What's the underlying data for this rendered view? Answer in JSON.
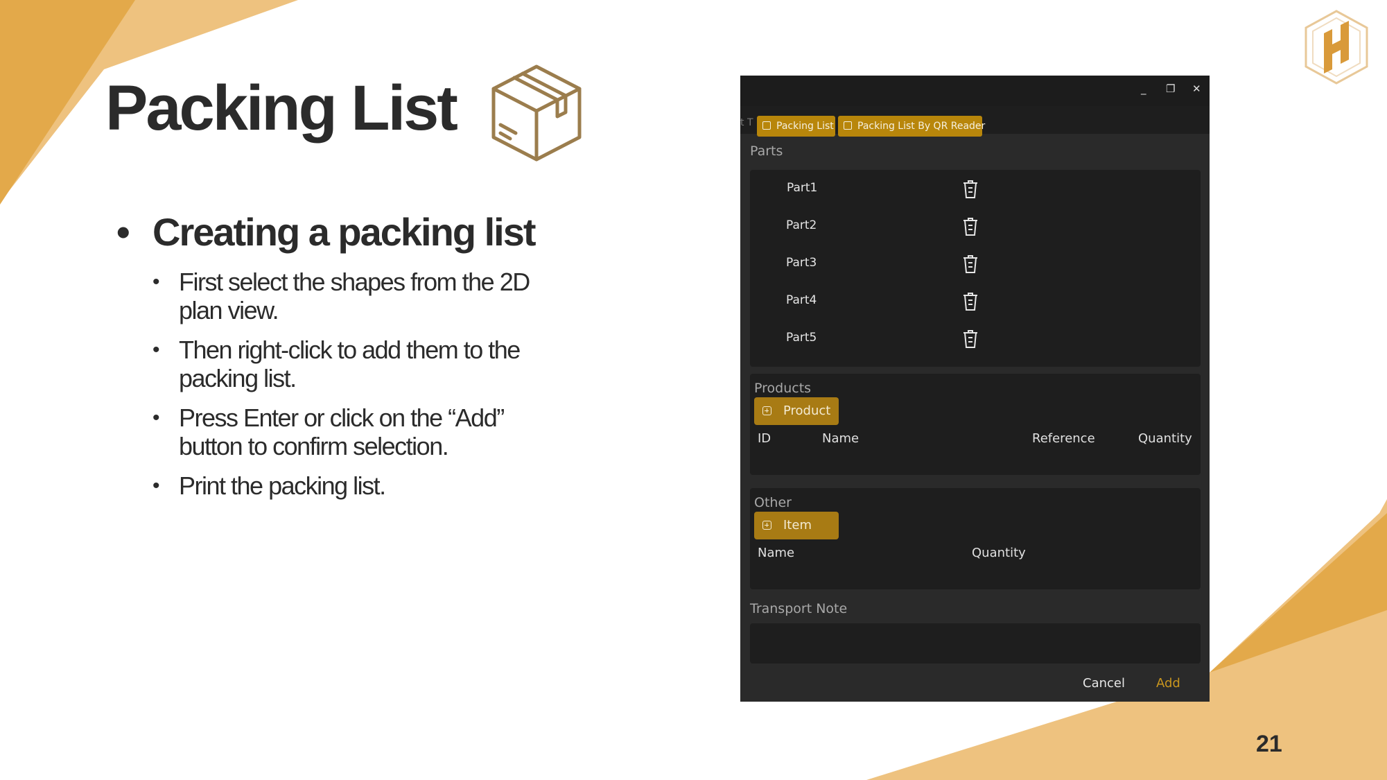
{
  "slide": {
    "title": "Packing List",
    "heading": "Creating a packing list",
    "bullets": [
      "First select the shapes from the 2D plan view.",
      "Then right-click to add them to the packing list.",
      "Press Enter or click on the “Add” button to confirm selection.",
      "Print the packing list."
    ],
    "page_number": "21",
    "accent_color": "#e8ad4b",
    "icons": [
      "box-icon",
      "logo-icon"
    ]
  },
  "window": {
    "title_controls": {
      "minimize": "_",
      "restore": "❐",
      "close": "✕"
    },
    "tab_fragment": "t T",
    "tabs": [
      "Packing List",
      "Packing List By QR Reader"
    ],
    "parts": {
      "label": "Parts",
      "items": [
        "Part1",
        "Part2",
        "Part3",
        "Part4",
        "Part5"
      ],
      "item_icon": "trash-icon"
    },
    "products": {
      "label": "Products",
      "add_button": "Product",
      "columns": [
        "ID",
        "Name",
        "Reference",
        "Quantity"
      ]
    },
    "other": {
      "label": "Other",
      "add_button": "Item",
      "columns": [
        "Name",
        "Quantity"
      ]
    },
    "transport_note": {
      "label": "Transport Note",
      "value": ""
    },
    "footer": {
      "cancel": "Cancel",
      "add": "Add"
    },
    "colors": {
      "background": "#2a2a2a",
      "panel": "#1e1e1e",
      "accent": "#b8860b",
      "add_text": "#c9961e"
    }
  }
}
